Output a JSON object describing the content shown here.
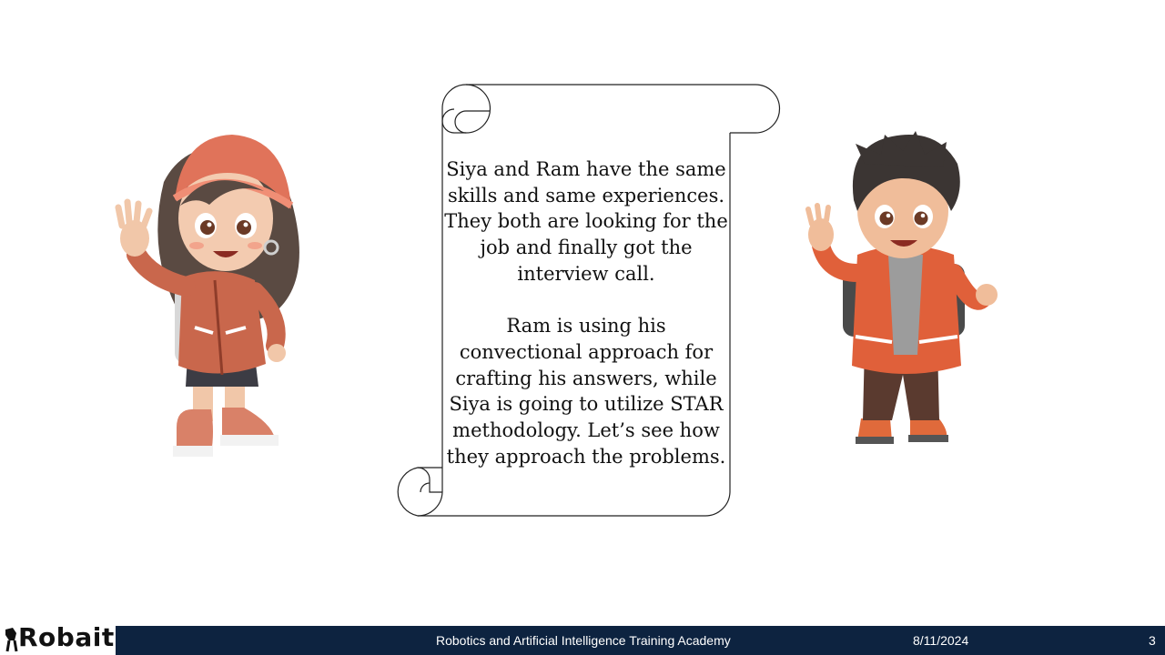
{
  "scroll": {
    "paragraph1": "Siya and Ram have the same skills and same experiences. They both are looking for the job and finally got the interview call.",
    "paragraph2": "Ram is using his convectional approach for crafting his answers, while Siya is going to utilize STAR methodology. Let’s see how they approach the problems."
  },
  "characters": {
    "left": "girl-character",
    "right": "boy-character"
  },
  "footer": {
    "title": "Robotics and Artificial Intelligence Training Academy",
    "date": "8/11/2024",
    "page_number": "3",
    "logo_text": "Robaita"
  },
  "colors": {
    "footer_bg": "#0d2340",
    "jacket": "#e0603a",
    "hair_girl": "#5a4a42",
    "hair_boy": "#3b3533"
  }
}
